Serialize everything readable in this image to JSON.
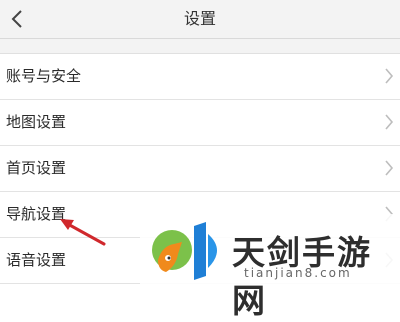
{
  "header": {
    "title": "设置",
    "back_icon": "chevron-left-icon"
  },
  "settings": {
    "items": [
      {
        "label": "账号与安全"
      },
      {
        "label": "地图设置"
      },
      {
        "label": "首页设置"
      },
      {
        "label": "导航设置"
      },
      {
        "label": "语音设置"
      }
    ]
  },
  "annotation": {
    "color": "#d0282c"
  },
  "watermark": {
    "name": "天剑手游网",
    "url": "tianjian8.com"
  }
}
